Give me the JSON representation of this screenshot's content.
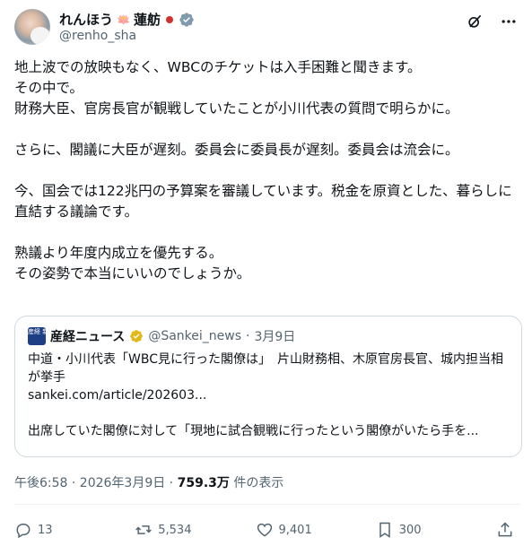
{
  "author": {
    "display_name": "れんほう",
    "lotus": "🪷",
    "kanji_name": "蓮舫",
    "handle": "@renho_sha"
  },
  "post": {
    "text": "地上波での放映もなく、WBCのチケットは入手困難と聞きます。\nその中で。\n財務大臣、官房長官が観戦していたことが小川代表の質問で明らかに。\n\nさらに、閣議に大臣が遅刻。委員会に委員長が遅刻。委員会は流会に。\n\n今、国会では122兆円の予算案を審議しています。税金を原資とした、暮らしに直結する議論です。\n\n熟議より年度内成立を優先する。\nその姿勢で本当にいいのでしょうか。"
  },
  "quote": {
    "logo_text": "産経 新聞",
    "name": "産経ニュース",
    "handle": "@Sankei_news",
    "sep": "·",
    "date": "3月9日",
    "text": "中道・小川代表「WBC見に行った閣僚は」　片山財務相、木原官房長官、城内担当相が挙手",
    "link": "sankei.com/article/202603...",
    "text2": "出席していた閣僚に対して「現地に試合観戦に行ったという閣僚がいたら手を..."
  },
  "meta": {
    "time_date": "午後6:58 · 2026年3月9日 · ",
    "views": "759.3万",
    "views_suffix": " 件の表示"
  },
  "actions": {
    "replies": "13",
    "reposts": "5,534",
    "likes": "9,401",
    "bookmarks": "300"
  },
  "colors": {
    "verified": "#1d9bf0",
    "gold_verified": "#e2b719",
    "text_secondary": "#536471",
    "border": "#cfd9de"
  },
  "icons": [
    "grok-icon",
    "more-icon",
    "reply-icon",
    "repost-icon",
    "like-icon",
    "bookmark-icon",
    "share-icon"
  ]
}
